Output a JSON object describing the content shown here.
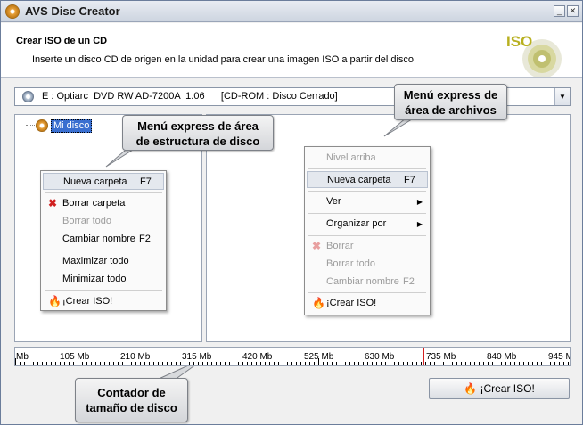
{
  "window": {
    "title": "AVS Disc Creator",
    "minimize": "_",
    "close": "✕"
  },
  "header": {
    "title": "Crear ISO de un CD",
    "subtitle": "Inserte un disco CD de origen en la unidad para crear una imagen ISO a partir del disco",
    "logo_text": "ISO"
  },
  "drive": {
    "value": "E : Optiarc  DVD RW AD-7200A  1.06      [CD-ROM : Disco Cerrado]"
  },
  "tree": {
    "root_label": "Mi disco"
  },
  "tree_menu": {
    "items": [
      {
        "label": "Nueva carpeta",
        "shortcut": "F7",
        "enabled": true,
        "highlight": true
      },
      {
        "label": "Borrar carpeta",
        "shortcut": "",
        "enabled": true,
        "icon": "delete-icon"
      },
      {
        "label": "Borrar todo",
        "shortcut": "",
        "enabled": false
      },
      {
        "label": "Cambiar nombre",
        "shortcut": "F2",
        "enabled": true
      },
      {
        "label": "Maximizar todo",
        "shortcut": "",
        "enabled": true
      },
      {
        "label": "Minimizar todo",
        "shortcut": "",
        "enabled": true
      },
      {
        "label": "¡Crear ISO!",
        "shortcut": "",
        "enabled": true,
        "icon": "flame-icon"
      }
    ]
  },
  "files_menu": {
    "items": [
      {
        "label": "Nivel arriba",
        "enabled": false
      },
      {
        "label": "Nueva carpeta",
        "shortcut": "F7",
        "enabled": true,
        "highlight": true
      },
      {
        "label": "Ver",
        "enabled": true,
        "submenu": true
      },
      {
        "label": "Organizar por",
        "enabled": true,
        "submenu": true
      },
      {
        "label": "Borrar",
        "enabled": false,
        "icon": "delete-icon"
      },
      {
        "label": "Borrar todo",
        "enabled": false
      },
      {
        "label": "Cambiar nombre",
        "shortcut": "F2",
        "enabled": false
      },
      {
        "label": "¡Crear ISO!",
        "enabled": true,
        "icon": "flame-icon"
      }
    ]
  },
  "callouts": {
    "tree": "Menú express de área\nde estructura de disco",
    "files": "Menú express de\nárea de archivos",
    "counter": "Contador de\ntamaño de disco"
  },
  "ruler": {
    "labels": [
      "Mb",
      "105 Mb",
      "210 Mb",
      "315 Mb",
      "420 Mb",
      "525 Mb",
      "630 Mb",
      "735 Mb",
      "840 Mb",
      "945 M"
    ]
  },
  "create_button": {
    "label": "¡Crear ISO!"
  },
  "colors": {
    "accent": "#3a6fd0",
    "marker": "#d42020",
    "delete": "#d02020",
    "flame": "#e85a10"
  }
}
